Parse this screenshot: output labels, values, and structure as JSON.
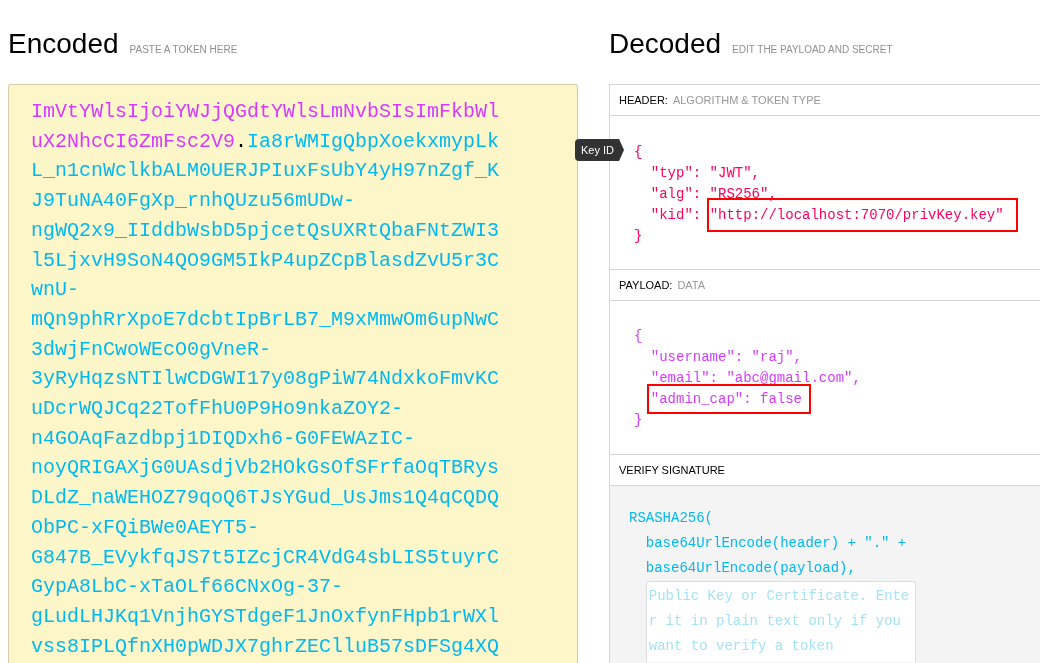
{
  "encoded": {
    "title": "Encoded",
    "subtitle": "PASTE A TOKEN HERE",
    "token": [
      {
        "kind": "payload",
        "text": "ImVtYWlsIjoiYWJjQGdtYWlsLmNvbSIsImFkbWluX2NhcCI6ZmFsc2V9"
      },
      {
        "kind": "separator",
        "text": "."
      },
      {
        "kind": "signature",
        "text": "Ia8rWMIgQbpXoekxmypLkL_n1cnWclkbALM0UERJPIuxFsUbY4yH97nZgf_KJ9TuNA40FgXp_rnhQUzu56mUDw-ngWQ2x9_IIddbWsbD5pjcetQsUXRtQbaFNtZWI3l5LjxvH9SoN4QO9GM5IkP4upZCpBlasdZvU5r3CwnU-mQn9phRrXpoE7dcbtIpBrLB7_M9xMmwOm6upNwC3dwjFnCwoWEcO0gVneR-3yRyHqzsNTIlwCDGWI17y08gPiW74NdxkoFmvKCuDcrWQJCq22TofFhU0P9Ho9nkaZOY2-n4GOAqFazdbpj1DIQDxh6-G0FEWAzIC-noyQRIGAXjG0UAsdjVb2HOkGsOfSFrfaOqTBRysDLdZ_naWEHOZ79qoQ6TJsYGud_UsJms1Q4qCQDQObPC-xFQiBWe0AEYT5-G847B_EVykfqJS7t5IZcjCR4VdG4sbLIS5tuyrCGypA8LbC-xTaOLf66CNxOg-37-gLudLHJKq1VnjhGYSTdgeF1JnOxfynFHpb1rWXlvss8IPLQfnXH0pWDJX7ghrZEClluB57sDFSg4XQ"
      }
    ]
  },
  "decoded": {
    "title": "Decoded",
    "subtitle": "EDIT THE PAYLOAD AND SECRET",
    "header": {
      "label": "HEADER:",
      "sublabel": "ALGORITHM & TOKEN TYPE",
      "tooltip": "Key ID",
      "open": "{",
      "entries": [
        {
          "key": "\"typ\":",
          "value": "\"JWT\",",
          "key_highlighted": false,
          "value_highlighted": false
        },
        {
          "key": "\"alg\":",
          "value": "\"RS256\",",
          "key_highlighted": false,
          "value_highlighted": false
        },
        {
          "key": "\"kid\":",
          "value": "\"http://localhost:7070/privKey.key\"",
          "key_highlighted": false,
          "value_highlighted": true
        }
      ],
      "close": "}"
    },
    "payload": {
      "label": "PAYLOAD:",
      "sublabel": "DATA",
      "open": "{",
      "entries": [
        {
          "key": "\"username\":",
          "value": "\"raj\",",
          "key_highlighted": false,
          "value_highlighted": false
        },
        {
          "key": "\"email\":",
          "value": "\"abc@gmail.com\",",
          "key_highlighted": false,
          "value_highlighted": false
        },
        {
          "key": "\"admin_cap\":",
          "value": "false",
          "key_highlighted": true,
          "value_highlighted": true
        }
      ],
      "close": "}"
    },
    "signature": {
      "label": "VERIFY SIGNATURE",
      "code": [
        {
          "kind": "line",
          "text": "RSASHA256(",
          "children": [
            {
              "kind": "line",
              "text": "base64UrlEncode(header) + \".\" +"
            },
            {
              "kind": "line",
              "text": "base64UrlEncode(payload),"
            },
            {
              "kind": "field",
              "placeholder": "Public Key or Certificate. Enter it in plain text only if you want to verify a token"
            }
          ]
        }
      ]
    }
  }
}
